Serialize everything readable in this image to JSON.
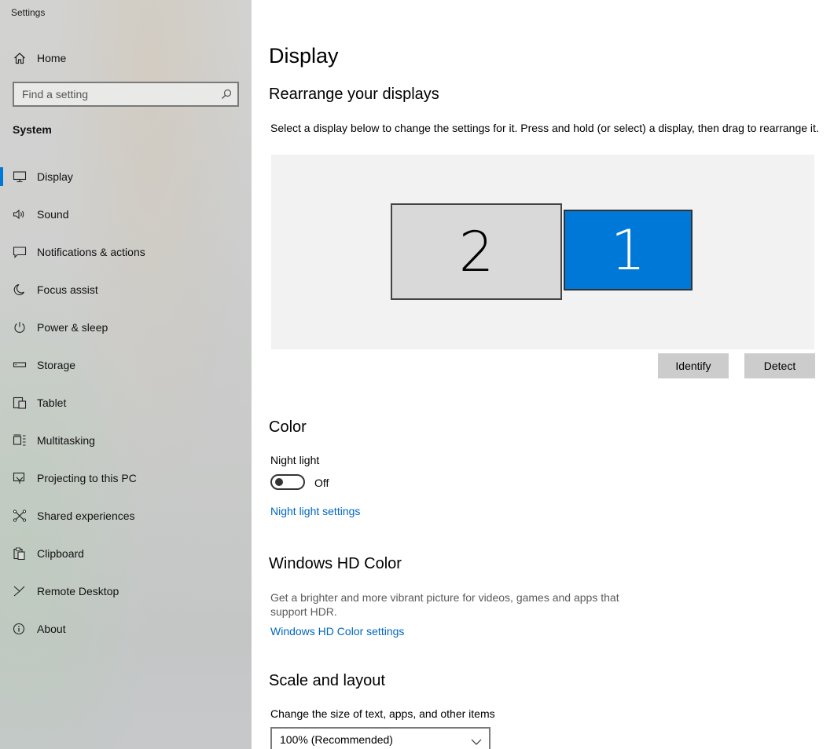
{
  "window": {
    "title": "Settings"
  },
  "sidebar": {
    "home_label": "Home",
    "search_placeholder": "Find a setting",
    "section_label": "System",
    "items": [
      {
        "label": "Display",
        "icon": "monitor-icon",
        "selected": true
      },
      {
        "label": "Sound",
        "icon": "speaker-icon"
      },
      {
        "label": "Notifications & actions",
        "icon": "message-icon"
      },
      {
        "label": "Focus assist",
        "icon": "moon-icon"
      },
      {
        "label": "Power & sleep",
        "icon": "power-icon"
      },
      {
        "label": "Storage",
        "icon": "storage-icon"
      },
      {
        "label": "Tablet",
        "icon": "tablet-icon"
      },
      {
        "label": "Multitasking",
        "icon": "multitasking-icon"
      },
      {
        "label": "Projecting to this PC",
        "icon": "projector-icon"
      },
      {
        "label": "Shared experiences",
        "icon": "share-icon"
      },
      {
        "label": "Clipboard",
        "icon": "clipboard-icon"
      },
      {
        "label": "Remote Desktop",
        "icon": "remote-icon"
      },
      {
        "label": "About",
        "icon": "info-icon"
      }
    ]
  },
  "main": {
    "title": "Display",
    "rearrange": {
      "heading": "Rearrange your displays",
      "description": "Select a display below to change the settings for it. Press and hold (or select) a display, then drag to rearrange it.",
      "monitor_2": "2",
      "monitor_1": "1",
      "identify_label": "Identify",
      "detect_label": "Detect"
    },
    "color": {
      "heading": "Color",
      "night_light_label": "Night light",
      "night_light_state": "Off",
      "night_light_link": "Night light settings"
    },
    "hdr": {
      "heading": "Windows HD Color",
      "description": "Get a brighter and more vibrant picture for videos, games and apps that support HDR.",
      "link": "Windows HD Color settings"
    },
    "scale": {
      "heading": "Scale and layout",
      "label": "Change the size of text, apps, and other items",
      "selected_value": "100% (Recommended)"
    }
  },
  "colors": {
    "accent": "#0078d7",
    "link": "#0067c0",
    "selected_monitor": "#0078d7",
    "unselected_monitor": "#d9d9d9"
  }
}
